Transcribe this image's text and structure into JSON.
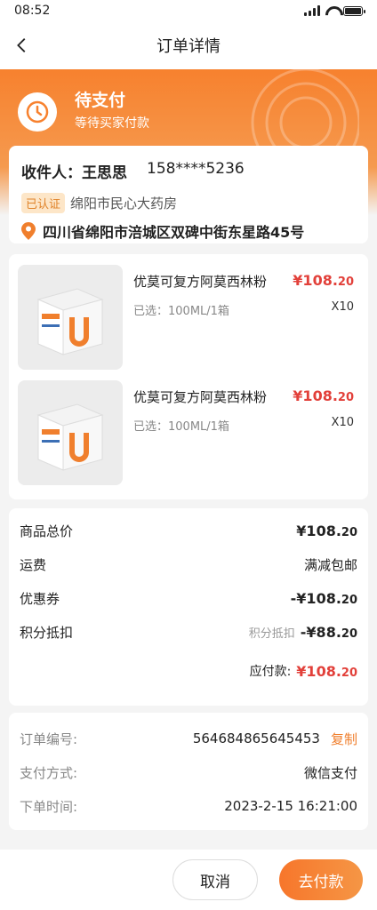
{
  "status_bar": {
    "time": "08:52"
  },
  "nav": {
    "title": "订单详情"
  },
  "order_status": {
    "title": "待支付",
    "subtitle": "等待买家付款"
  },
  "address": {
    "recipient_label": "收件人：王思思",
    "phone": "158****5236",
    "verified_badge": "已认证",
    "store": "绵阳市民心大药房",
    "full_address": "四川省绵阳市涪城区双碑中街东星路45号"
  },
  "goods": [
    {
      "name": "优莫可复方阿莫西林粉",
      "price_int": "¥108.",
      "price_dec": "20",
      "spec": "已选：100ML/1箱",
      "qty": "X10"
    },
    {
      "name": "优莫可复方阿莫西林粉",
      "price_int": "¥108.",
      "price_dec": "20",
      "spec": "已选：100ML/1箱",
      "qty": "X10"
    }
  ],
  "summary": {
    "total_label": "商品总价",
    "total_int": "¥108.",
    "total_dec": "20",
    "shipping_label": "运费",
    "shipping_value": "满减包邮",
    "coupon_label": "优惠券",
    "coupon_int": "-¥108.",
    "coupon_dec": "20",
    "points_label": "积分抵扣",
    "points_hint": "积分抵扣",
    "points_int": "-¥88.",
    "points_dec": "20",
    "payable_label": "应付款:",
    "payable_int": "¥108.",
    "payable_dec": "20"
  },
  "order_info": {
    "order_no_label": "订单编号:",
    "order_no": "564684865645453",
    "copy_label": "复制",
    "pay_method_label": "支付方式:",
    "pay_method": "微信支付",
    "time_label": "下单时间:",
    "time": "2023-2-15  16:21:00"
  },
  "actions": {
    "cancel": "取消",
    "pay": "去付款"
  },
  "colors": {
    "accent": "#f7812e",
    "price": "#e2403a"
  }
}
